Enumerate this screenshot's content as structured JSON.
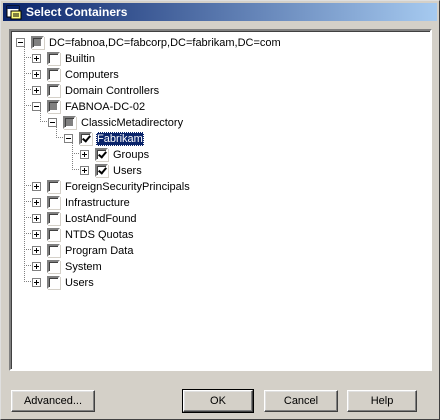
{
  "window": {
    "title": "Select Containers",
    "icon": "app-window-icon"
  },
  "tree": {
    "nodes": [
      {
        "label": "DC=fabnoa,DC=fabcorp,DC=fabrikam,DC=com",
        "state": "partial",
        "expander": "minus",
        "selected": false
      },
      {
        "label": "Builtin",
        "state": "unchecked",
        "expander": "plus",
        "selected": false
      },
      {
        "label": "Computers",
        "state": "unchecked",
        "expander": "plus",
        "selected": false
      },
      {
        "label": "Domain Controllers",
        "state": "unchecked",
        "expander": "plus",
        "selected": false
      },
      {
        "label": "FABNOA-DC-02",
        "state": "partial",
        "expander": "minus",
        "selected": false
      },
      {
        "label": "ClassicMetadirectory",
        "state": "partial",
        "expander": "minus",
        "selected": false
      },
      {
        "label": "Fabrikam",
        "state": "checked",
        "expander": "minus",
        "selected": true
      },
      {
        "label": "Groups",
        "state": "checked",
        "expander": "plus",
        "selected": false
      },
      {
        "label": "Users",
        "state": "checked",
        "expander": "plus",
        "selected": false
      },
      {
        "label": "ForeignSecurityPrincipals",
        "state": "unchecked",
        "expander": "plus",
        "selected": false
      },
      {
        "label": "Infrastructure",
        "state": "unchecked",
        "expander": "plus",
        "selected": false
      },
      {
        "label": "LostAndFound",
        "state": "unchecked",
        "expander": "plus",
        "selected": false
      },
      {
        "label": "NTDS Quotas",
        "state": "unchecked",
        "expander": "plus",
        "selected": false
      },
      {
        "label": "Program Data",
        "state": "unchecked",
        "expander": "plus",
        "selected": false
      },
      {
        "label": "System",
        "state": "unchecked",
        "expander": "plus",
        "selected": false
      },
      {
        "label": "Users",
        "state": "unchecked",
        "expander": "plus",
        "selected": false
      }
    ]
  },
  "buttons": {
    "advanced": "Advanced...",
    "ok": "OK",
    "cancel": "Cancel",
    "help": "Help"
  },
  "colors": {
    "selection": "#0a246a",
    "face": "#d4d0c8"
  }
}
